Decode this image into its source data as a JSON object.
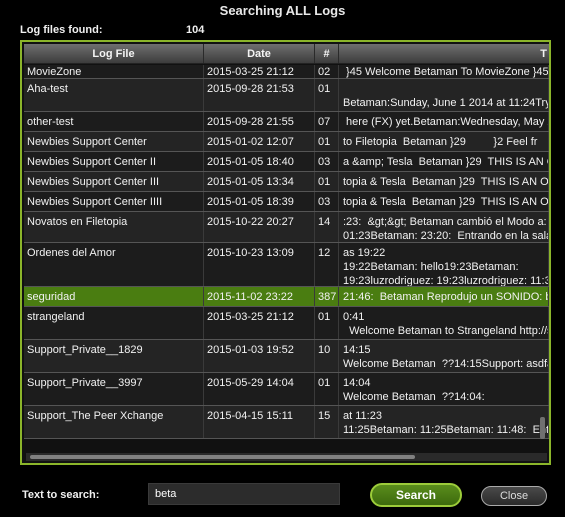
{
  "window": {
    "title": "Searching ALL Logs"
  },
  "summary": {
    "label": "Log files found:",
    "count": "104"
  },
  "table": {
    "columns": [
      "Log File",
      "Date",
      "#",
      "T"
    ],
    "rows": [
      {
        "file": "MovieZone",
        "date": "2015-03-25 21:12",
        "num": "02",
        "text": " }45 Welcome Betaman To MovieZone }45",
        "selected": false
      },
      {
        "file": "Aha-test",
        "date": "2015-09-28 21:53",
        "num": "01",
        "text": "\nBetaman:Sunday, June 1 2014 at 11:24Tryin",
        "selected": false
      },
      {
        "file": "other-test",
        "date": "2015-09-28 21:55",
        "num": "07",
        "text": " here (FX) yet.Betaman:Wednesday, May 28",
        "selected": false
      },
      {
        "file": "Newbies Support Center",
        "date": "2015-01-02 12:07",
        "num": "01",
        "text": "to Filetopia  Betaman }29         }2 Feel fr",
        "selected": false
      },
      {
        "file": "Newbies Support Center II",
        "date": "2015-01-05 18:40",
        "num": "03",
        "text": "a &amp; Tesla  Betaman }29  THIS IS AN OV",
        "selected": false
      },
      {
        "file": "Newbies Support Center III",
        "date": "2015-01-05 13:34",
        "num": "01",
        "text": "topia & Tesla  Betaman }29  THIS IS AN OV",
        "selected": false
      },
      {
        "file": "Newbies Support Center IIII",
        "date": "2015-01-05 18:39",
        "num": "03",
        "text": "topia & Tesla  Betaman }29  THIS IS AN OV",
        "selected": false
      },
      {
        "file": "Novatos en Filetopia",
        "date": "2015-10-22 20:27",
        "num": "14",
        "text": ":23:  &gt;&gt; Betaman cambió el Modo a:\n01:23Betaman: 23:20:  Entrando en la sala.",
        "selected": false
      },
      {
        "file": "Ordenes del Amor",
        "date": "2015-10-23 13:09",
        "num": "12",
        "text": "as 19:22\n19:22Betaman: hello19:23Betaman:\n19:23luzrodriguez: 19:23luzrodriguez: 11:36",
        "selected": false
      },
      {
        "file": "seguridad",
        "date": "2015-11-02 23:22",
        "num": "387",
        "text": "21:46:  Betaman Reprodujo un SONIDO: ba",
        "selected": true
      },
      {
        "file": "strangeland",
        "date": "2015-03-25 21:12",
        "num": "01",
        "text": "0:41\n  Welcome Betaman to Strangeland http://s",
        "selected": false
      },
      {
        "file": "Support_Private__1829",
        "date": "2015-01-03 19:52",
        "num": "10",
        "text": "14:15\nWelcome Betaman  ??14:15Support: asdfas",
        "selected": false
      },
      {
        "file": "Support_Private__3997",
        "date": "2015-05-29 14:04",
        "num": "01",
        "text": "14:04\nWelcome Betaman  ??14:04:",
        "selected": false
      },
      {
        "file": "Support_The Peer Xchange",
        "date": "2015-04-15 15:11",
        "num": "15",
        "text": "at 11:23\n11:25Betaman: 11:25Betaman: 11:48:  Enter",
        "selected": false
      }
    ]
  },
  "search": {
    "label": "Text to search:",
    "value": "beta",
    "button_label": "Search"
  },
  "close": {
    "label": "Close"
  },
  "colors": {
    "accent": "#8bb52a",
    "selected_row": "#4a7d11"
  }
}
